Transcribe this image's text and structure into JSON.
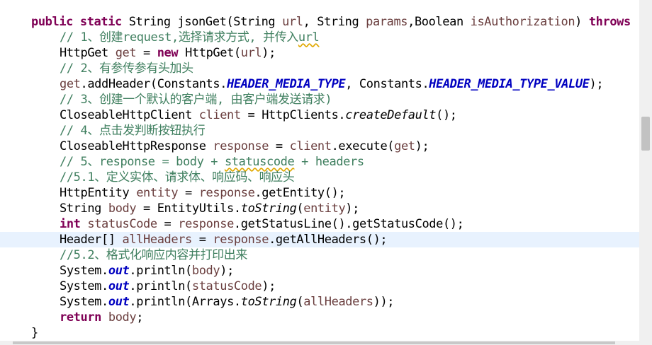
{
  "editor": {
    "lines": [
      {
        "indent": 44,
        "tokens": [
          {
            "c": "kw",
            "t": "public"
          },
          {
            "c": "",
            "t": " "
          },
          {
            "c": "kw",
            "t": "static"
          },
          {
            "c": "",
            "t": " String jsonGet(String "
          },
          {
            "c": "var",
            "t": "url"
          },
          {
            "c": "",
            "t": ", String "
          },
          {
            "c": "var",
            "t": "params"
          },
          {
            "c": "",
            "t": ",Boolean "
          },
          {
            "c": "var",
            "t": "isAuthorization"
          },
          {
            "c": "",
            "t": ") "
          },
          {
            "c": "kw",
            "t": "throws"
          }
        ]
      },
      {
        "indent": 84,
        "tokens": [
          {
            "c": "cm",
            "t": "// 1、创建request,选择请求方式, 并传入"
          },
          {
            "c": "cm sq",
            "t": "url"
          }
        ]
      },
      {
        "indent": 84,
        "tokens": [
          {
            "c": "",
            "t": "HttpGet "
          },
          {
            "c": "var",
            "t": "get"
          },
          {
            "c": "",
            "t": " = "
          },
          {
            "c": "kw",
            "t": "new"
          },
          {
            "c": "",
            "t": " HttpGet("
          },
          {
            "c": "var",
            "t": "url"
          },
          {
            "c": "",
            "t": ");"
          }
        ]
      },
      {
        "indent": 84,
        "tokens": [
          {
            "c": "cm",
            "t": "// 2、有参传参有头加头"
          }
        ]
      },
      {
        "indent": 84,
        "tokens": [
          {
            "c": "var",
            "t": "get"
          },
          {
            "c": "",
            "t": ".addHeader(Constants."
          },
          {
            "c": "fi",
            "t": "HEADER_MEDIA_TYPE"
          },
          {
            "c": "",
            "t": ", Constants."
          },
          {
            "c": "fi",
            "t": "HEADER_MEDIA_TYPE_VALUE"
          },
          {
            "c": "",
            "t": ");"
          }
        ]
      },
      {
        "indent": 84,
        "tokens": [
          {
            "c": "cm",
            "t": "// 3、创建一个默认的客户端, 由客户端发送请求)"
          }
        ]
      },
      {
        "indent": 84,
        "tokens": [
          {
            "c": "",
            "t": "CloseableHttpClient "
          },
          {
            "c": "var",
            "t": "client"
          },
          {
            "c": "",
            "t": " = HttpClients."
          },
          {
            "c": "it",
            "t": "createDefault"
          },
          {
            "c": "",
            "t": "();"
          }
        ]
      },
      {
        "indent": 84,
        "tokens": [
          {
            "c": "cm",
            "t": "// 4、点击发判断按钮执行"
          }
        ]
      },
      {
        "indent": 84,
        "tokens": [
          {
            "c": "",
            "t": "CloseableHttpResponse "
          },
          {
            "c": "var",
            "t": "response"
          },
          {
            "c": "",
            "t": " = "
          },
          {
            "c": "var",
            "t": "client"
          },
          {
            "c": "",
            "t": ".execute("
          },
          {
            "c": "var",
            "t": "get"
          },
          {
            "c": "",
            "t": ");"
          }
        ]
      },
      {
        "indent": 84,
        "tokens": [
          {
            "c": "cm",
            "t": "// 5、response = body + "
          },
          {
            "c": "cm sq",
            "t": "statuscode"
          },
          {
            "c": "cm",
            "t": " + headers"
          }
        ]
      },
      {
        "indent": 84,
        "tokens": [
          {
            "c": "cm",
            "t": "//5.1、定义实体、请求体、响应码、响应头"
          }
        ]
      },
      {
        "indent": 84,
        "tokens": [
          {
            "c": "",
            "t": "HttpEntity "
          },
          {
            "c": "var",
            "t": "entity"
          },
          {
            "c": "",
            "t": " = "
          },
          {
            "c": "var",
            "t": "response"
          },
          {
            "c": "",
            "t": ".getEntity();"
          }
        ]
      },
      {
        "indent": 84,
        "tokens": [
          {
            "c": "",
            "t": "String "
          },
          {
            "c": "var",
            "t": "body"
          },
          {
            "c": "",
            "t": " = EntityUtils."
          },
          {
            "c": "it",
            "t": "toString"
          },
          {
            "c": "",
            "t": "("
          },
          {
            "c": "var",
            "t": "entity"
          },
          {
            "c": "",
            "t": ");"
          }
        ]
      },
      {
        "indent": 84,
        "tokens": [
          {
            "c": "kw",
            "t": "int"
          },
          {
            "c": "",
            "t": " "
          },
          {
            "c": "var",
            "t": "statusCode"
          },
          {
            "c": "",
            "t": " = "
          },
          {
            "c": "var",
            "t": "response"
          },
          {
            "c": "",
            "t": ".getStatusLine().getStatusCode();"
          }
        ]
      },
      {
        "indent": 84,
        "highlight": true,
        "tokens": [
          {
            "c": "",
            "t": "Header[] "
          },
          {
            "c": "var",
            "t": "allHeaders"
          },
          {
            "c": "",
            "t": " = "
          },
          {
            "c": "var",
            "t": "response"
          },
          {
            "c": "",
            "t": ".getAllHeaders();"
          }
        ]
      },
      {
        "indent": 84,
        "tokens": [
          {
            "c": "cm",
            "t": "//5.2、格式化响应内容并打印出来"
          }
        ]
      },
      {
        "indent": 84,
        "tokens": [
          {
            "c": "",
            "t": "System."
          },
          {
            "c": "fs",
            "t": "out"
          },
          {
            "c": "",
            "t": ".println("
          },
          {
            "c": "var",
            "t": "body"
          },
          {
            "c": "",
            "t": ");"
          }
        ]
      },
      {
        "indent": 84,
        "tokens": [
          {
            "c": "",
            "t": "System."
          },
          {
            "c": "fs",
            "t": "out"
          },
          {
            "c": "",
            "t": ".println("
          },
          {
            "c": "var",
            "t": "statusCode"
          },
          {
            "c": "",
            "t": ");"
          }
        ]
      },
      {
        "indent": 84,
        "tokens": [
          {
            "c": "",
            "t": "System."
          },
          {
            "c": "fs",
            "t": "out"
          },
          {
            "c": "",
            "t": ".println(Arrays."
          },
          {
            "c": "it",
            "t": "toString"
          },
          {
            "c": "",
            "t": "("
          },
          {
            "c": "var",
            "t": "allHeaders"
          },
          {
            "c": "",
            "t": "));"
          }
        ]
      },
      {
        "indent": 84,
        "tokens": [
          {
            "c": "kw",
            "t": "return"
          },
          {
            "c": "",
            "t": " "
          },
          {
            "c": "var",
            "t": "body"
          },
          {
            "c": "",
            "t": ";"
          }
        ]
      },
      {
        "indent": 44,
        "tokens": [
          {
            "c": "",
            "t": "}"
          }
        ]
      }
    ]
  }
}
